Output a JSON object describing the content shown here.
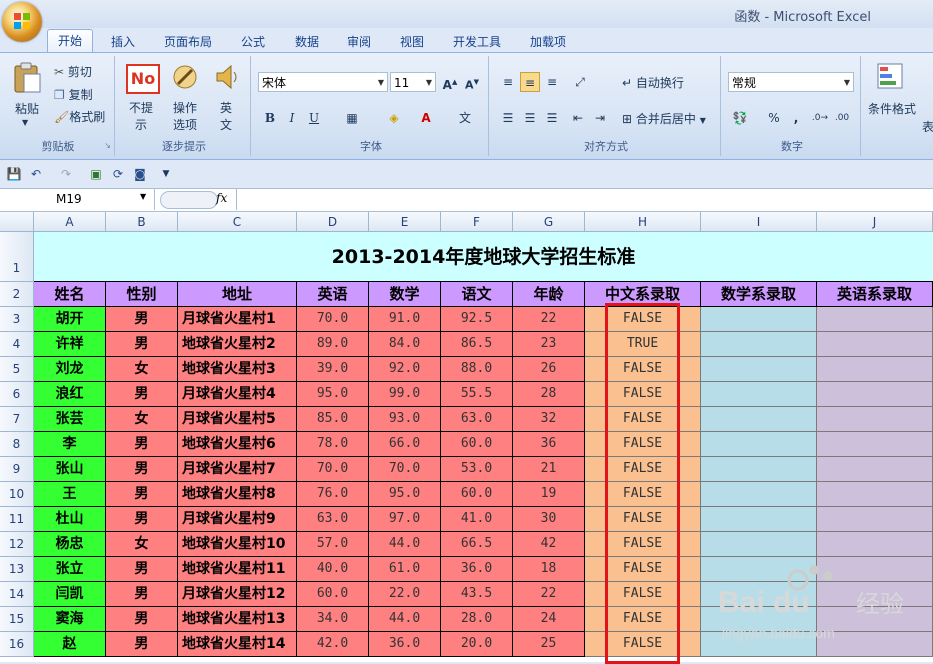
{
  "window": {
    "title": "函数 - Microsoft Excel"
  },
  "tabs": [
    "开始",
    "插入",
    "页面布局",
    "公式",
    "数据",
    "审阅",
    "视图",
    "开发工具",
    "加载项"
  ],
  "ribbon": {
    "clipboard": {
      "label": "剪贴板",
      "paste": "粘贴",
      "cut": "剪切",
      "copy": "复制",
      "format_painter": "格式刷"
    },
    "stepwise": {
      "label": "逐步提示",
      "no_prompt": "不提示",
      "operation_tips": "操作选项",
      "english": "英文",
      "no_logo": "No"
    },
    "font": {
      "label": "字体",
      "name": "宋体",
      "size": "11"
    },
    "alignment": {
      "label": "对齐方式",
      "wrap": "自动换行",
      "merge": "合并后居中"
    },
    "number": {
      "label": "数字",
      "format": "常规"
    },
    "styles": {
      "conditional": "条件格式",
      "partial": "表"
    }
  },
  "formula_bar": {
    "name_box": "M19",
    "fx": "fx",
    "value": ""
  },
  "columns": [
    "A",
    "B",
    "C",
    "D",
    "E",
    "F",
    "G",
    "H",
    "I",
    "J"
  ],
  "sheet": {
    "title": "2013-2014年度地球大学招生标准",
    "headers": [
      "姓名",
      "性别",
      "地址",
      "英语",
      "数学",
      "语文",
      "年龄",
      "中文系录取",
      "数学系录取",
      "英语系录取"
    ],
    "rows": [
      [
        "胡开",
        "男",
        "月球省火星村1",
        "70.0",
        "91.0",
        "92.5",
        "22",
        "FALSE",
        "",
        ""
      ],
      [
        "许祥",
        "男",
        "地球省火星村2",
        "89.0",
        "84.0",
        "86.5",
        "23",
        "TRUE",
        "",
        ""
      ],
      [
        "刘龙",
        "女",
        "地球省火星村3",
        "39.0",
        "92.0",
        "88.0",
        "26",
        "FALSE",
        "",
        ""
      ],
      [
        "浪红",
        "男",
        "月球省火星村4",
        "95.0",
        "99.0",
        "55.5",
        "28",
        "FALSE",
        "",
        ""
      ],
      [
        "张芸",
        "女",
        "月球省火星村5",
        "85.0",
        "93.0",
        "63.0",
        "32",
        "FALSE",
        "",
        ""
      ],
      [
        "李",
        "男",
        "地球省火星村6",
        "78.0",
        "66.0",
        "60.0",
        "36",
        "FALSE",
        "",
        ""
      ],
      [
        "张山",
        "男",
        "月球省火星村7",
        "70.0",
        "70.0",
        "53.0",
        "21",
        "FALSE",
        "",
        ""
      ],
      [
        "王",
        "男",
        "地球省火星村8",
        "76.0",
        "95.0",
        "60.0",
        "19",
        "FALSE",
        "",
        ""
      ],
      [
        "杜山",
        "男",
        "月球省火星村9",
        "63.0",
        "97.0",
        "41.0",
        "30",
        "FALSE",
        "",
        ""
      ],
      [
        "杨忠",
        "女",
        "地球省火星村10",
        "57.0",
        "44.0",
        "66.5",
        "42",
        "FALSE",
        "",
        ""
      ],
      [
        "张立",
        "男",
        "地球省火星村11",
        "40.0",
        "61.0",
        "36.0",
        "18",
        "FALSE",
        "",
        ""
      ],
      [
        "闫凯",
        "男",
        "月球省火星村12",
        "60.0",
        "22.0",
        "43.5",
        "22",
        "FALSE",
        "",
        ""
      ],
      [
        "窦海",
        "男",
        "地球省火星村13",
        "34.0",
        "44.0",
        "28.0",
        "24",
        "FALSE",
        "",
        ""
      ],
      [
        "赵",
        "男",
        "地球省火星村14",
        "42.0",
        "36.0",
        "20.0",
        "25",
        "FALSE",
        "",
        ""
      ]
    ]
  },
  "colors": {
    "title_bg": "#ccffff",
    "header_bg": "#cc99ff",
    "name_bg": "#33ff33",
    "data_bg": "#ff8080",
    "col_h_bg": "#fac090",
    "col_i_bg": "#b7dee8",
    "col_j_bg": "#ccc0da",
    "highlight": "#e0141b"
  },
  "watermark": {
    "brand": "Bai du",
    "sub": "经验",
    "url": "jingyan.baidu.com"
  }
}
